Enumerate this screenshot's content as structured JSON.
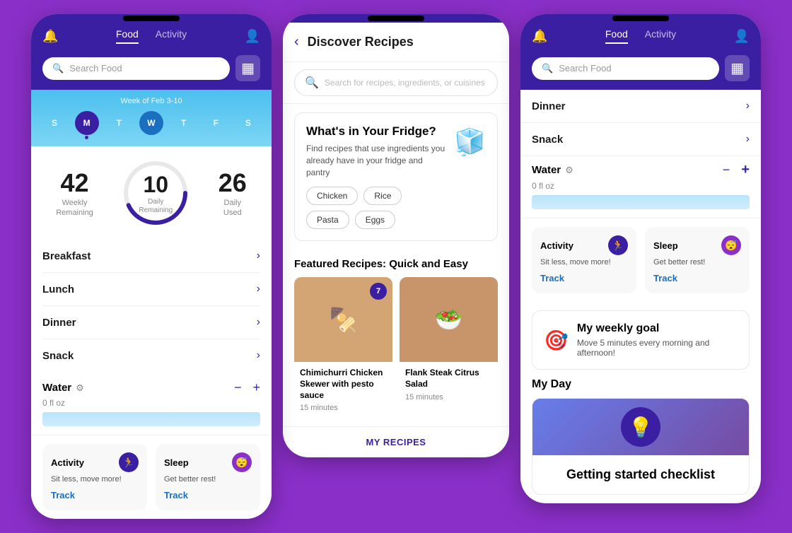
{
  "background_color": "#8B2FC9",
  "phone1": {
    "nav": {
      "food_tab": "Food",
      "activity_tab": "Activity"
    },
    "search": {
      "placeholder": "Search Food"
    },
    "week": {
      "label": "Week of Feb 3-10",
      "days": [
        "S",
        "M",
        "T",
        "W",
        "T",
        "F",
        "S"
      ],
      "today_index": 2,
      "selected_index": 3
    },
    "stats": {
      "weekly_number": "42",
      "weekly_label": "Weekly\nRemaining",
      "daily_number": "10",
      "daily_label": "Daily\nRemaining",
      "used_number": "26",
      "used_label": "Daily\nUsed"
    },
    "meals": [
      {
        "name": "Breakfast"
      },
      {
        "name": "Lunch"
      },
      {
        "name": "Dinner"
      },
      {
        "name": "Snack"
      }
    ],
    "water": {
      "name": "Water",
      "amount": "0 fl oz"
    },
    "activity_card": {
      "title": "Activity",
      "subtitle": "Sit less, move more!",
      "track": "Track"
    },
    "sleep_card": {
      "title": "Sleep",
      "subtitle": "Get better rest!",
      "track": "Track"
    }
  },
  "phone2": {
    "title": "Discover Recipes",
    "search_placeholder": "Search for recipes, ingredients, or cuisines",
    "fridge": {
      "title": "What's in Your Fridge?",
      "description": "Find recipes that use ingredients you already have in your fridge and pantry",
      "ingredients": [
        "Chicken",
        "Rice",
        "Pasta",
        "Eggs"
      ]
    },
    "featured_title": "Featured Recipes: Quick and Easy",
    "recipes": [
      {
        "name": "Chimichurri Chicken Skewer with pesto sauce",
        "time": "15 minutes",
        "badge": "7"
      },
      {
        "name": "Flank Steak Citrus Salad",
        "time": "15 minutes"
      }
    ],
    "my_recipes_btn": "MY RECIPES"
  },
  "phone3": {
    "nav": {
      "food_tab": "Food",
      "activity_tab": "Activity"
    },
    "search": {
      "placeholder": "Search Food"
    },
    "dinner_label": "Dinner",
    "snack_label": "Snack",
    "water": {
      "name": "Water",
      "amount": "0 fl oz"
    },
    "activity_card": {
      "title": "Activity",
      "subtitle": "Sit less, move more!",
      "track": "Track"
    },
    "sleep_card": {
      "title": "Sleep",
      "subtitle": "Get better rest!",
      "track": "Track"
    },
    "weekly_goal": {
      "title": "My weekly goal",
      "description": "Move 5 minutes every morning and afternoon!"
    },
    "my_day": {
      "title": "My Day",
      "checklist": {
        "title": "Getting started checklist"
      }
    }
  },
  "icons": {
    "bell": "🔔",
    "person": "👤",
    "search": "🔍",
    "barcode": "▦",
    "chevron_right": "›",
    "minus": "−",
    "plus": "+",
    "back": "‹",
    "gear": "⚙",
    "activity": "🏃",
    "sleep": "😴",
    "goal": "🎯",
    "bulb": "💡",
    "fridge": "🧊"
  }
}
